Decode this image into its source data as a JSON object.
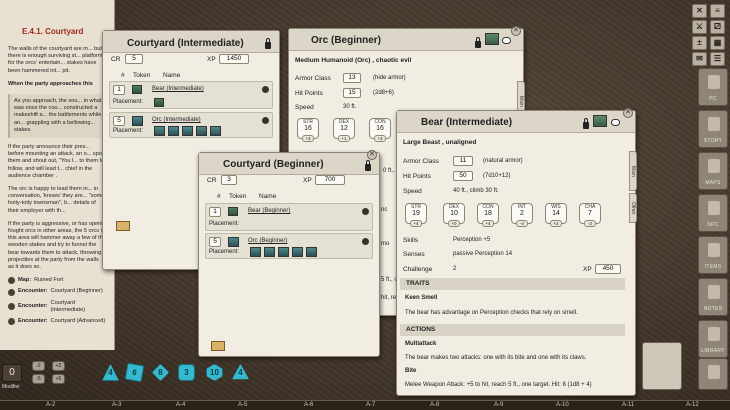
{
  "story": {
    "title": "E.4.1. Courtyard",
    "para1": "The walls of the courtyard are m... but there is enough surviving st... platforms for the orcs' entertain... stakes have been hammered int... pit.",
    "para2": "When the party approaches this",
    "box": "As you approach, the sou... in what was once the cou... constructed a makeshift a... the battlements while an... grappling with a bellowing... stakes.",
    "para3": "If the party announce their pres... before mounting an attack, an o... spot them and shout out, \"You l... to them to follow, and will lead t... chief in the audience chamber .",
    "para4": "The orc is happy to lead them in... in conversation, 'knows' they are... \"some hoity-toity townsman\", b... details of their employer with th...",
    "para5": "If the party is aggressive, or has openly fought orcs in other areas, the 5 orcs in this area will hammer away a few of the wooden stakes and try to funnel the bear towards them to attack, throwing projectiles at the party from the walls as it does so.",
    "links": [
      {
        "label": "Map:",
        "value": "Ruined Fort"
      },
      {
        "label": "Encounter:",
        "value": "Courtyard (Beginner)"
      },
      {
        "label": "Encounter:",
        "value": "Courtyard (intermediate)"
      },
      {
        "label": "Encounter:",
        "value": "Courtyard (Advanced)"
      }
    ]
  },
  "enc_intermediate": {
    "title": "Courtyard (Intermediate)",
    "cr_label": "CR",
    "cr": "5",
    "xp_label": "XP",
    "xp": "1450",
    "col_num": "#",
    "col_token": "Token",
    "col_name": "Name",
    "rows": [
      {
        "count": "1",
        "name": "Bear (Intermediate)",
        "placement_label": "Placement:"
      },
      {
        "count": "5",
        "name": "Orc (Intermediate)",
        "placement_label": "Placement:"
      }
    ]
  },
  "enc_beginner": {
    "title": "Courtyard (Beginner)",
    "cr_label": "CR",
    "cr": "3",
    "xp_label": "XP",
    "xp": "700",
    "col_num": "#",
    "col_token": "Token",
    "col_name": "Name",
    "rows": [
      {
        "count": "1",
        "name": "Bear (Beginner)",
        "placement_label": "Placement:"
      },
      {
        "count": "5",
        "name": "Orc (Beginner)",
        "placement_label": "Placement:"
      }
    ]
  },
  "orc": {
    "title": "Orc (Beginner)",
    "type": "Medium Humanoid (Orc) , chaotic evil",
    "ac_label": "Armor Class",
    "ac": "13",
    "ac_note": "(hide armor)",
    "hp_label": "Hit Points",
    "hp": "15",
    "hp_note": "(2d8+6)",
    "speed_label": "Speed",
    "speed": "30 ft.",
    "stats": [
      {
        "name": "STR",
        "value": "16",
        "mod": "+3"
      },
      {
        "name": "DEX",
        "value": "12",
        "mod": "+1"
      },
      {
        "name": "CON",
        "value": "16",
        "mod": "+3"
      }
    ],
    "tab_main": "Main",
    "partial1": "0 ft., p",
    "partial2": "nc",
    "partial3": "mo",
    "partial4": "5 ft., o",
    "partial5": "hit, re"
  },
  "bear": {
    "title": "Bear (Intermediate)",
    "type": "Large Beast , unaligned",
    "ac_label": "Armor Class",
    "ac": "11",
    "ac_note": "(natural armor)",
    "hp_label": "Hit Points",
    "hp": "50",
    "hp_note": "(7d10+12)",
    "speed_label": "Speed",
    "speed": "40 ft., climb 30 ft.",
    "stats": [
      {
        "name": "STR",
        "value": "19",
        "mod": "+4"
      },
      {
        "name": "DEX",
        "value": "10",
        "mod": "+0"
      },
      {
        "name": "CON",
        "value": "18",
        "mod": "+4"
      },
      {
        "name": "INT",
        "value": "2",
        "mod": "-4"
      },
      {
        "name": "WIS",
        "value": "14",
        "mod": "+2"
      },
      {
        "name": "CHA",
        "value": "7",
        "mod": "-2"
      }
    ],
    "skills_label": "Skills",
    "skills": "Perception +5",
    "senses_label": "Senses",
    "senses": "passive Perception 14",
    "challenge_label": "Challenge",
    "challenge": "2",
    "xp_label": "XP",
    "xp": "450",
    "traits_header": "TRAITS",
    "trait1_name": "Keen Smell",
    "trait1_text": "The bear has advantage on Perception checks that rely on smell.",
    "actions_header": "ACTIONS",
    "action1_name": "Multiattack",
    "action1_text": "The bear makes two attacks: one with its bite and one with its claws.",
    "action2_name": "Bite",
    "action2_text": "Melee Weapon Attack: +5 to hit, reach 5 ft., one target. Hit: 8 (1d8 + 4)",
    "tab_main": "Main",
    "tab_other": "Other"
  },
  "dice_tray": {
    "modifier": "0",
    "mod_label": "Modifier",
    "buttons": [
      "-2",
      "+2",
      "-5",
      "+5"
    ],
    "dice": [
      "4",
      "6",
      "8",
      "3",
      "10",
      "4"
    ]
  },
  "right_bar": {
    "items": [
      "PC",
      "STORY",
      "MAPS",
      "NPC",
      "ITEMS",
      "NOTES",
      "LIBRARY"
    ]
  },
  "ruler": {
    "labels": [
      "A-2",
      "A-3",
      "A-4",
      "A-5",
      "A-6",
      "A-7",
      "A-8",
      "A-9",
      "A-10",
      "A-11",
      "A-12"
    ]
  }
}
